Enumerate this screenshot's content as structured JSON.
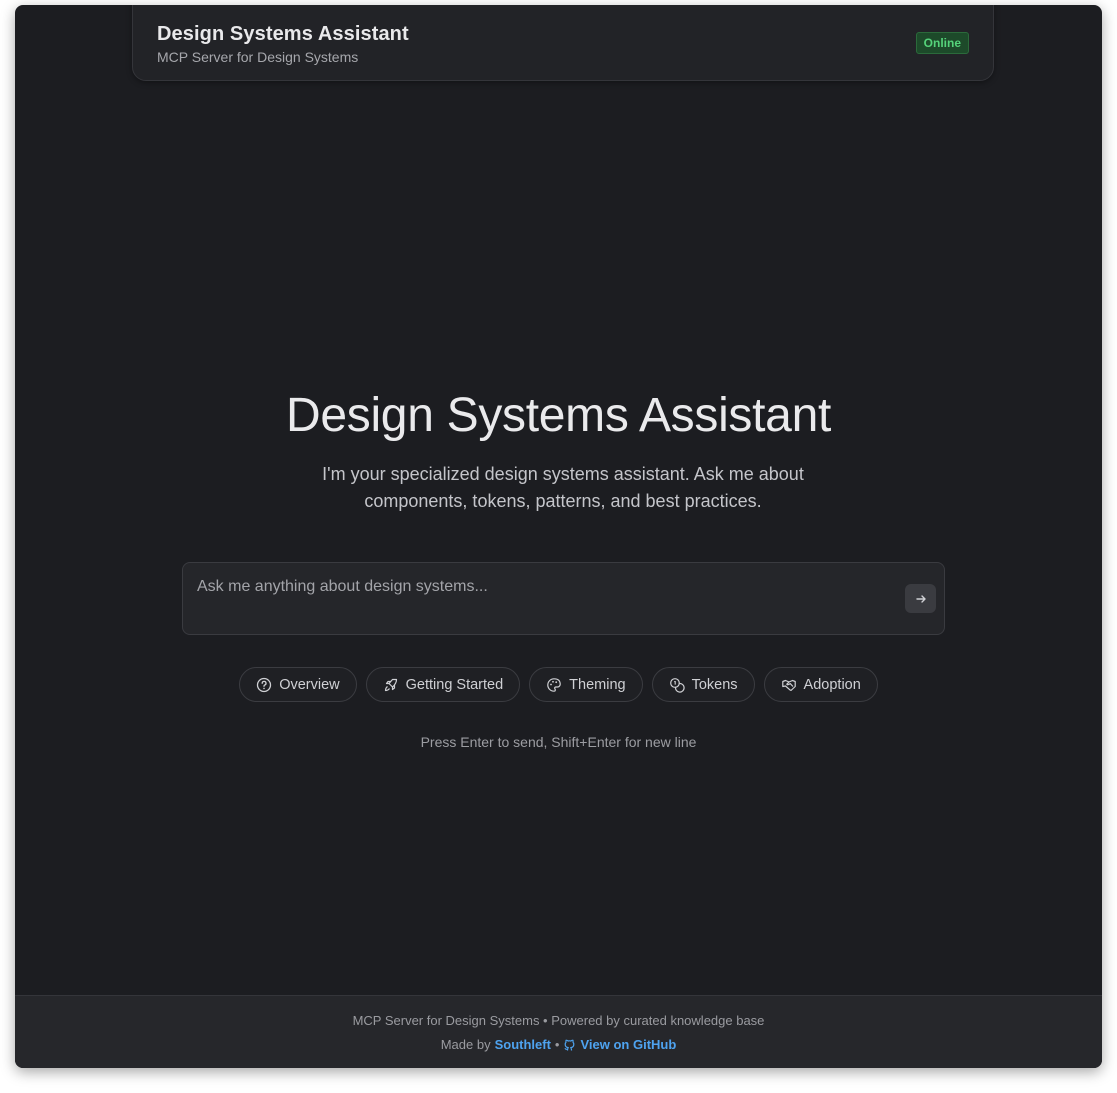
{
  "header": {
    "title": "Design Systems Assistant",
    "subtitle": "MCP Server for Design Systems",
    "status": "Online"
  },
  "hero": {
    "title": "Design Systems Assistant",
    "subtitle": "I'm your specialized design systems assistant. Ask me about components, tokens, patterns, and best practices."
  },
  "chat": {
    "placeholder": "Ask me anything about design systems...",
    "value": "",
    "send_icon": "arrow-right-icon"
  },
  "chips": [
    {
      "label": "Overview",
      "icon": "help-circle-icon"
    },
    {
      "label": "Getting Started",
      "icon": "rocket-icon"
    },
    {
      "label": "Theming",
      "icon": "palette-icon"
    },
    {
      "label": "Tokens",
      "icon": "coins-icon"
    },
    {
      "label": "Adoption",
      "icon": "handshake-icon"
    }
  ],
  "hint": "Press Enter to send, Shift+Enter for new line",
  "footer": {
    "line1": "MCP Server for Design Systems • Powered by curated knowledge base",
    "made_by": "Made by",
    "author": "Southleft",
    "separator": "•",
    "github_label": "View on GitHub",
    "github_icon": "github-icon"
  },
  "colors": {
    "background": "#1c1d21",
    "accent_link": "#4ea3f0",
    "status_green": "#55d37a"
  }
}
